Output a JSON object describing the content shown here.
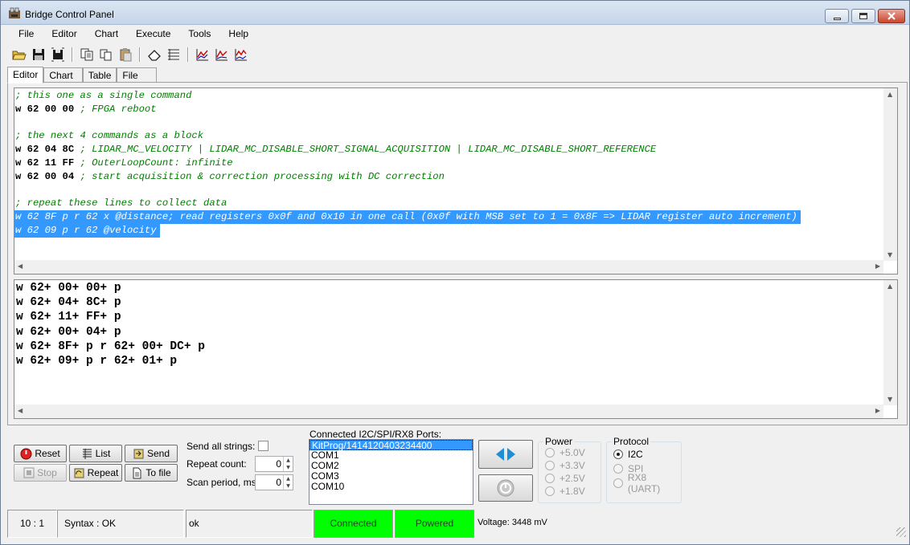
{
  "window": {
    "title": "Bridge Control Panel"
  },
  "menu": [
    "File",
    "Editor",
    "Chart",
    "Execute",
    "Tools",
    "Help"
  ],
  "toolbar": {
    "icons": [
      "open-folder-icon",
      "save-icon",
      "save-as-icon",
      "copy-icon",
      "cut-icon",
      "paste-icon",
      "eraser-icon",
      "list-icon",
      "chart-icon",
      "chart-zoom-icon",
      "chart-multi-icon"
    ]
  },
  "tabs": [
    "Editor",
    "Chart",
    "Table",
    "File"
  ],
  "editor": {
    "lines": [
      {
        "type": "comment",
        "text": "; this one as a single command"
      },
      {
        "type": "cmd",
        "cmd": "w 62 00 00",
        "comment": " ; FPGA reboot"
      },
      {
        "type": "blank",
        "text": ""
      },
      {
        "type": "comment",
        "text": "; the next 4 commands as a block"
      },
      {
        "type": "cmd",
        "cmd": "w 62 04 8C",
        "comment": " ; LIDAR_MC_VELOCITY | LIDAR_MC_DISABLE_SHORT_SIGNAL_ACQUISITION | LIDAR_MC_DISABLE_SHORT_REFERENCE"
      },
      {
        "type": "cmd",
        "cmd": "w 62 11 FF",
        "comment": " ; OuterLoopCount: infinite"
      },
      {
        "type": "cmd",
        "cmd": "w 62 00 04",
        "comment": " ; start acquisition & correction processing with DC correction"
      },
      {
        "type": "blank",
        "text": ""
      },
      {
        "type": "comment",
        "text": "; repeat these lines to collect data"
      },
      {
        "type": "selected",
        "text": "w 62 8F p r 62 x @distance; read registers 0x0f and 0x10 in one call (0x0f with MSB set to 1 = 0x8F => LIDAR register auto increment)"
      },
      {
        "type": "selected",
        "text": "w 62 09 p r 62 @velocity"
      }
    ]
  },
  "output": {
    "lines": [
      "w 62+ 00+ 00+ p",
      "w 62+ 04+ 8C+ p",
      "w 62+ 11+ FF+ p",
      "w 62+ 00+ 04+ p",
      "w 62+ 8F+ p r 62+ 00+ DC+ p",
      "w 62+ 09+ p r 62+ 01+ p"
    ]
  },
  "controls": {
    "reset": "Reset",
    "list": "List",
    "send": "Send",
    "stop": "Stop",
    "repeat": "Repeat",
    "to_file": "To file",
    "send_all_label": "Send all strings:",
    "repeat_count_label": "Repeat count:",
    "repeat_count_value": "0",
    "scan_period_label": "Scan period, ms:",
    "scan_period_value": "0"
  },
  "ports": {
    "label": "Connected I2C/SPI/RX8 Ports:",
    "items": [
      "KitProg/1414120403234400",
      "COM1",
      "COM2",
      "COM3",
      "COM10"
    ],
    "selected_index": 0
  },
  "power": {
    "title": "Power",
    "options": [
      "+5.0V",
      "+3.3V",
      "+2.5V",
      "+1.8V"
    ]
  },
  "protocol": {
    "title": "Protocol",
    "options": [
      "I2C",
      "SPI",
      "RX8 (UART)"
    ],
    "selected": "I2C"
  },
  "status": {
    "position": "10 : 1",
    "syntax": "Syntax : OK",
    "message": "ok",
    "connected": "Connected",
    "powered": "Powered",
    "voltage": "Voltage: 3448 mV",
    "status_green": "#00ff00"
  },
  "colors": {
    "comment": "#008000",
    "selection": "#3399ff"
  }
}
